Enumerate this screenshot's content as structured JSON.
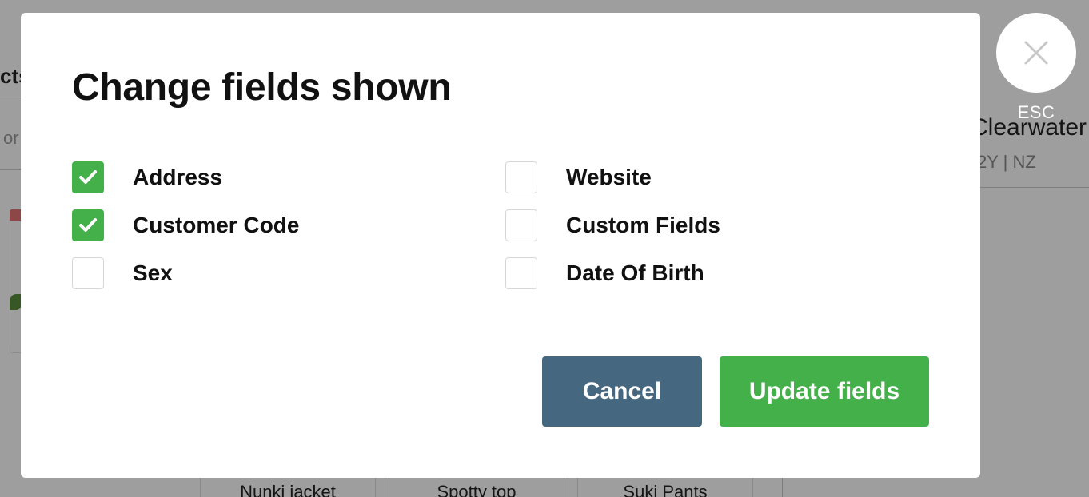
{
  "background": {
    "left_tab_fragment": "cts",
    "left_search_fragment": "or",
    "customer_name_fragment": "Clearwater",
    "customer_meta_fragment": "2Y | NZ",
    "products": [
      "Nunki jacket",
      "Spotty top",
      "Suki Pants"
    ]
  },
  "close": {
    "icon": "close-icon",
    "label": "ESC"
  },
  "modal": {
    "title": "Change fields shown",
    "fields": [
      {
        "label": "Address",
        "checked": true
      },
      {
        "label": "Customer Code",
        "checked": true
      },
      {
        "label": "Sex",
        "checked": false
      },
      {
        "label": "Website",
        "checked": false
      },
      {
        "label": "Custom Fields",
        "checked": false
      },
      {
        "label": "Date Of Birth",
        "checked": false
      }
    ],
    "cancel_label": "Cancel",
    "update_label": "Update fields"
  },
  "colors": {
    "accent_green": "#43b04a",
    "cancel_blue": "#45677f"
  }
}
